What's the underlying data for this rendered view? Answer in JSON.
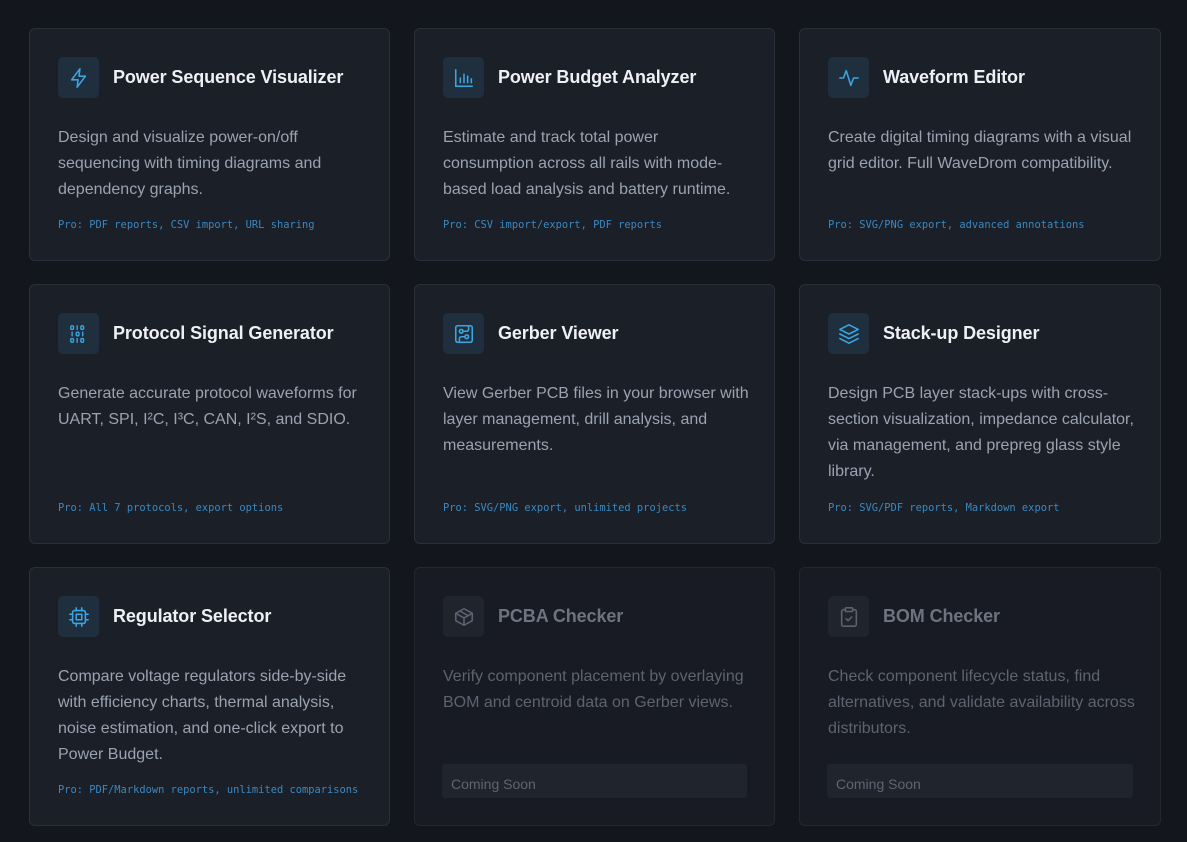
{
  "tools": [
    {
      "icon": "lightning-icon",
      "title": "Power Sequence Visualizer",
      "description": "Design and visualize power-on/off sequencing with timing diagrams and dependency graphs.",
      "pro": "Pro: PDF reports, CSV import, URL sharing"
    },
    {
      "icon": "bar-chart-icon",
      "title": "Power Budget Analyzer",
      "description": "Estimate and track total power consumption across all rails with mode-based load analysis and battery runtime.",
      "pro": "Pro: CSV import/export, PDF reports"
    },
    {
      "icon": "waveform-icon",
      "title": "Waveform Editor",
      "description": "Create digital timing diagrams with a visual grid editor. Full WaveDrom compatibility.",
      "pro": "Pro: SVG/PNG export, advanced annotations"
    },
    {
      "icon": "binary-icon",
      "title": "Protocol Signal Generator",
      "description": "Generate accurate protocol waveforms for UART, SPI, I²C, I³C, CAN, I²S, and SDIO.",
      "pro": "Pro: All 7 protocols, export options"
    },
    {
      "icon": "circuit-board-icon",
      "title": "Gerber Viewer",
      "description": "View Gerber PCB files in your browser with layer management, drill analysis, and measurements.",
      "pro": "Pro: SVG/PNG export, unlimited projects"
    },
    {
      "icon": "layers-icon",
      "title": "Stack-up Designer",
      "description": "Design PCB layer stack-ups with cross-section visualization, impedance calculator, via management, and prepreg glass style library.",
      "pro": "Pro: SVG/PDF reports, Markdown export"
    },
    {
      "icon": "chip-icon",
      "title": "Regulator Selector",
      "description": "Compare voltage regulators side-by-side with efficiency charts, thermal analysis, noise estimation, and one-click export to Power Budget.",
      "pro": "Pro: PDF/Markdown reports, unlimited comparisons"
    },
    {
      "icon": "package-icon",
      "title": "PCBA Checker",
      "description": "Verify component placement by overlaying BOM and centroid data on Gerber views.",
      "status": "Coming Soon"
    },
    {
      "icon": "clipboard-check-icon",
      "title": "BOM Checker",
      "description": "Check component lifecycle status, find alternatives, and validate availability across distributors.",
      "status": "Coming Soon"
    }
  ],
  "colors": {
    "accent": "#3aa5df",
    "background": "#13161d",
    "card": "#1b1f28"
  }
}
